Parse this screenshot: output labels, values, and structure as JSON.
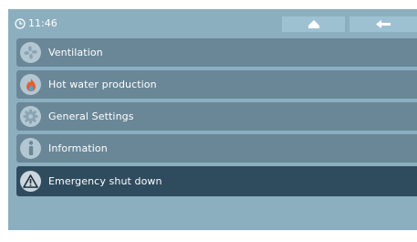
{
  "status": {
    "time": "11:46",
    "clock_icon": "clock-icon"
  },
  "toolbar": {
    "home_icon": "home-icon",
    "back_icon": "back-arrow-icon"
  },
  "menu": {
    "items": [
      {
        "label": "Ventilation",
        "icon": "fan-icon"
      },
      {
        "label": "Hot water production",
        "icon": "flame-icon"
      },
      {
        "label": "General Settings",
        "icon": "gear-icon"
      },
      {
        "label": "Information",
        "icon": "info-icon"
      },
      {
        "label": "Emergency shut down",
        "icon": "warning-icon"
      }
    ]
  },
  "colors": {
    "screen_bg": "#8cafc0",
    "item_bg": "#6a8797",
    "item_active_bg": "#2f4c5f",
    "button_bg": "#9ec1d2"
  }
}
